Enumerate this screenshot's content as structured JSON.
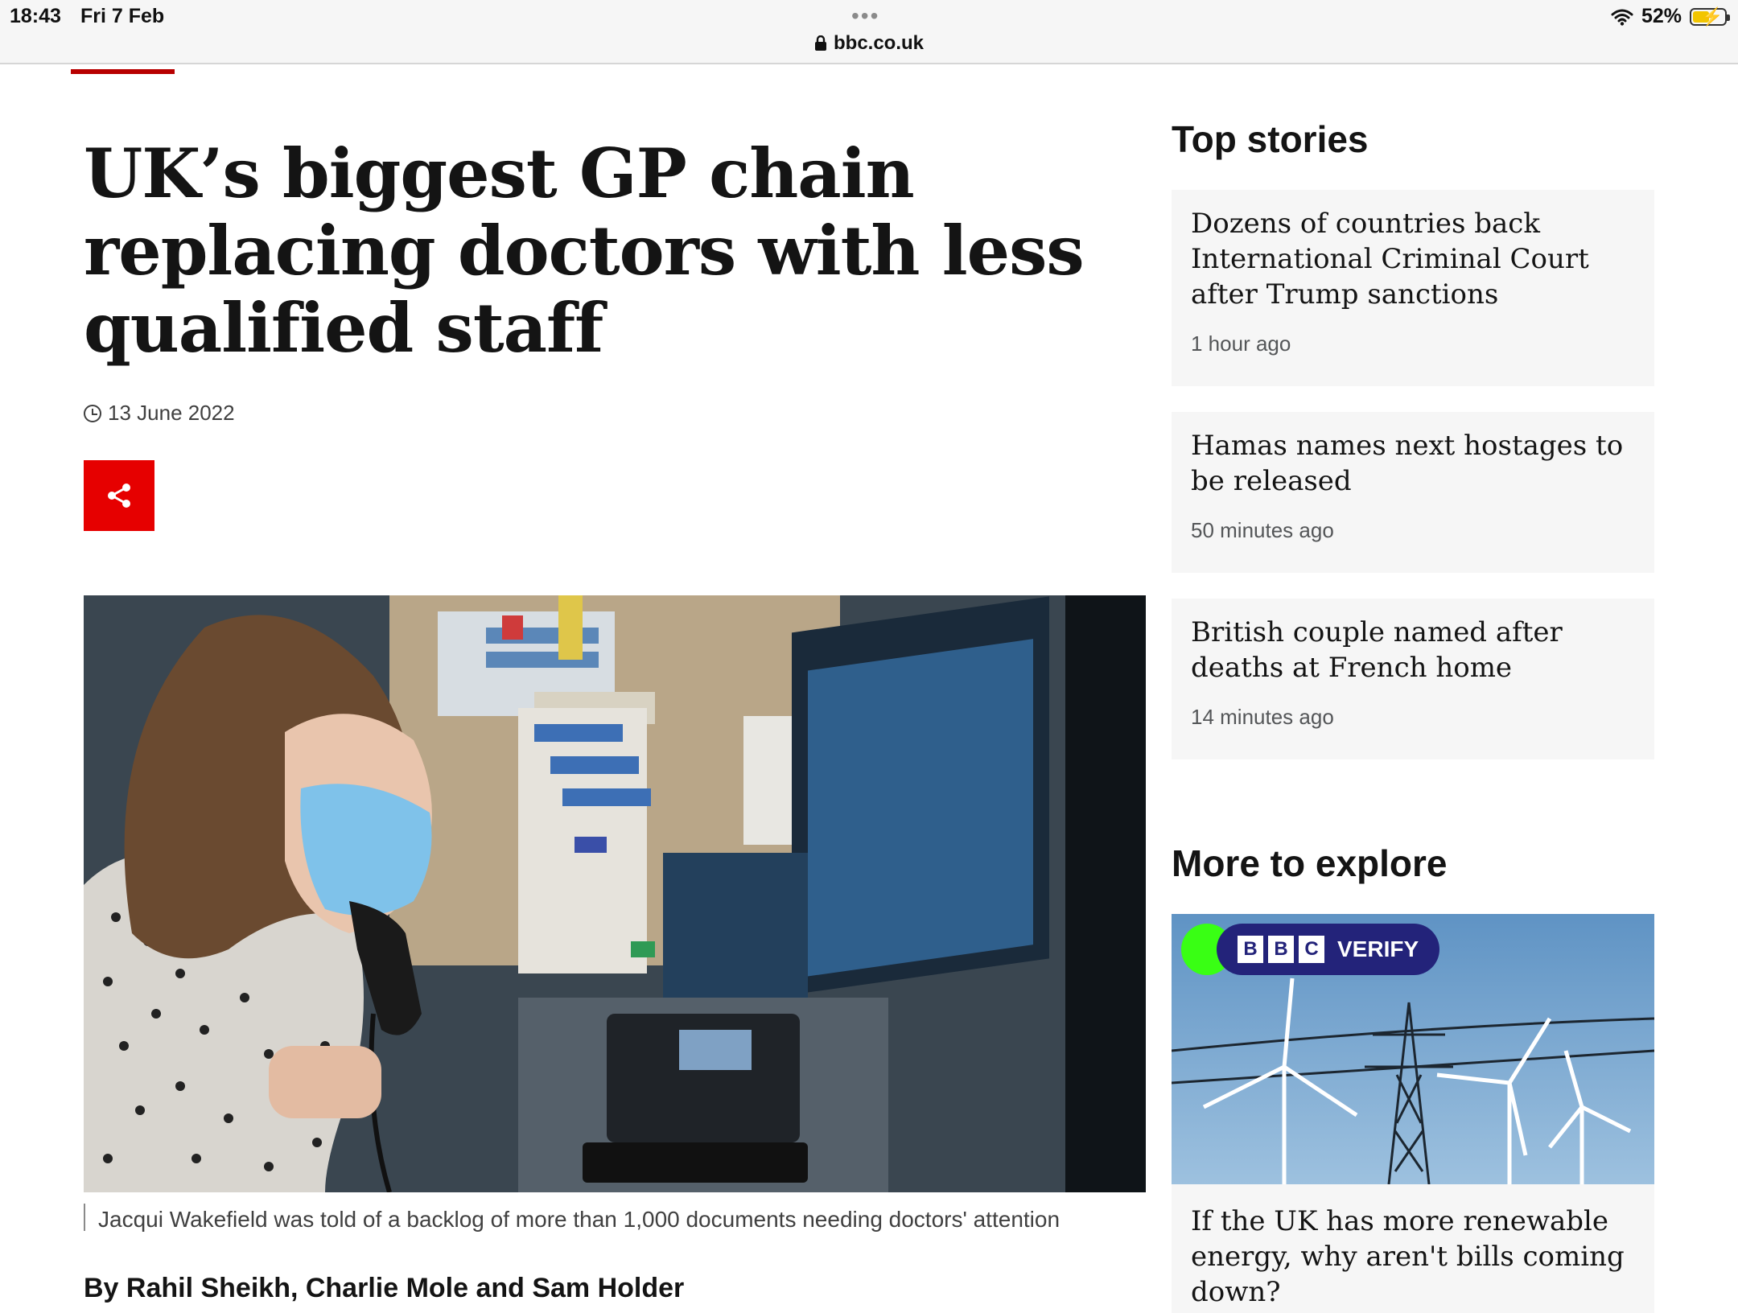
{
  "status_bar": {
    "time": "18:43",
    "date": "Fri 7 Feb",
    "url": "bbc.co.uk",
    "battery": "52%",
    "battery_level": 0.52
  },
  "article": {
    "headline": "UK’s biggest GP chain replacing doctors with less qualified staff",
    "date": "13 June 2022",
    "share_icon": "share-icon",
    "image_caption": "Jacqui Wakefield was told of a backlog of more than 1,000 documents needing doctors' attention",
    "byline": "By Rahil Sheikh, Charlie Mole and Sam Holder"
  },
  "sidebar": {
    "top_stories_title": "Top stories",
    "stories": [
      {
        "headline": "Dozens of countries back International Criminal Court after Trump sanctions",
        "time": "1 hour ago"
      },
      {
        "headline": "Hamas names next hostages to be released",
        "time": "50 minutes ago"
      },
      {
        "headline": "British couple named after deaths at French home",
        "time": "14 minutes ago"
      }
    ],
    "more_title": "More to explore",
    "explore": {
      "badge_bbc": [
        "B",
        "B",
        "C"
      ],
      "badge_text": "VERIFY",
      "headline": "If the UK has more renewable energy, why aren't bills coming down?"
    }
  },
  "colors": {
    "bbc_red": "#b80000",
    "share_red": "#e60000",
    "card_bg": "#f6f6f6",
    "verify_navy": "#23237a",
    "verify_green": "#39ff14"
  }
}
